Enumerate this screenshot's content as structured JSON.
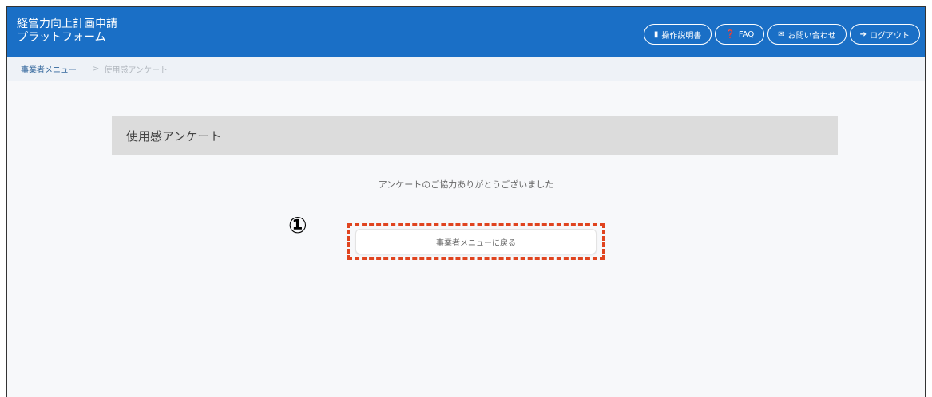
{
  "header": {
    "brand_line1": "経営力向上計画申請",
    "brand_line2": "プラットフォーム",
    "buttons": [
      {
        "icon": "▮",
        "label": "操作説明書"
      },
      {
        "icon": "❓",
        "label": "FAQ"
      },
      {
        "icon": "✉",
        "label": "お問い合わせ"
      },
      {
        "icon": "➔",
        "label": "ログアウト"
      }
    ]
  },
  "breadcrumb": {
    "home": "事業者メニュー",
    "separator": ">",
    "current": "使用感アンケート"
  },
  "page": {
    "title": "使用感アンケート",
    "thanks_message": "アンケートのご協力ありがとうございました",
    "back_button": "事業者メニューに戻る",
    "marker": "①"
  },
  "colors": {
    "header_bg": "#1a6fc6",
    "highlight_border": "#e0441f"
  }
}
